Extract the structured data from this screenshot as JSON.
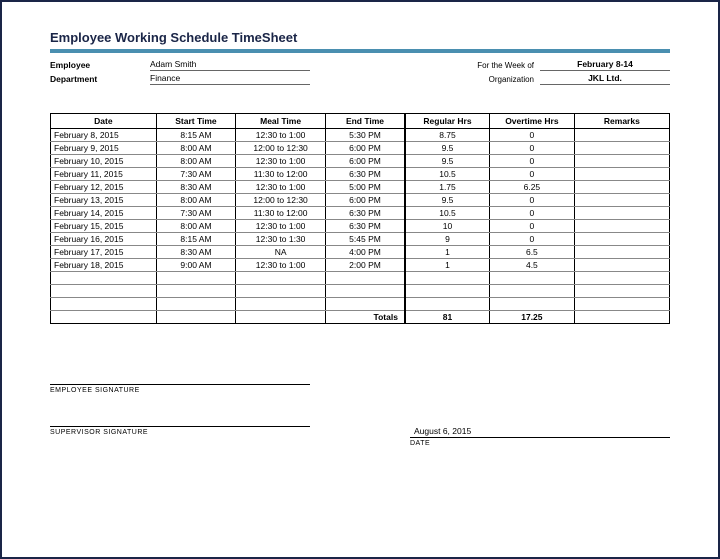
{
  "title": "Employee Working Schedule TimeSheet",
  "info": {
    "employee_label": "Employee",
    "employee_value": "Adam Smith",
    "department_label": "Department",
    "department_value": "Finance",
    "week_label": "For the Week of",
    "week_value": "February 8-14",
    "org_label": "Organization",
    "org_value": "JKL Ltd."
  },
  "headers": {
    "date": "Date",
    "start": "Start Time",
    "meal": "Meal Time",
    "end": "End Time",
    "regular": "Regular Hrs",
    "overtime": "Overtime Hrs",
    "remarks": "Remarks"
  },
  "rows": [
    {
      "date": "February 8, 2015",
      "start": "8:15 AM",
      "meal": "12:30 to 1:00",
      "end": "5:30 PM",
      "reg": "8.75",
      "ot": "0",
      "rem": ""
    },
    {
      "date": "February 9, 2015",
      "start": "8:00 AM",
      "meal": "12:00 to 12:30",
      "end": "6:00 PM",
      "reg": "9.5",
      "ot": "0",
      "rem": ""
    },
    {
      "date": "February 10, 2015",
      "start": "8:00 AM",
      "meal": "12:30 to 1:00",
      "end": "6:00 PM",
      "reg": "9.5",
      "ot": "0",
      "rem": ""
    },
    {
      "date": "February 11, 2015",
      "start": "7:30 AM",
      "meal": "11:30 to 12:00",
      "end": "6:30 PM",
      "reg": "10.5",
      "ot": "0",
      "rem": ""
    },
    {
      "date": "February 12, 2015",
      "start": "8:30 AM",
      "meal": "12:30 to 1:00",
      "end": "5:00 PM",
      "reg": "1.75",
      "ot": "6.25",
      "rem": ""
    },
    {
      "date": "February 13, 2015",
      "start": "8:00 AM",
      "meal": "12:00 to 12:30",
      "end": "6:00 PM",
      "reg": "9.5",
      "ot": "0",
      "rem": ""
    },
    {
      "date": "February 14, 2015",
      "start": "7:30 AM",
      "meal": "11:30 to 12:00",
      "end": "6:30 PM",
      "reg": "10.5",
      "ot": "0",
      "rem": ""
    },
    {
      "date": "February 15, 2015",
      "start": "8:00 AM",
      "meal": "12:30 to 1:00",
      "end": "6:30 PM",
      "reg": "10",
      "ot": "0",
      "rem": ""
    },
    {
      "date": "February 16, 2015",
      "start": "8:15 AM",
      "meal": "12:30 to 1:30",
      "end": "5:45 PM",
      "reg": "9",
      "ot": "0",
      "rem": ""
    },
    {
      "date": "February 17, 2015",
      "start": "8:30 AM",
      "meal": "NA",
      "end": "4:00 PM",
      "reg": "1",
      "ot": "6.5",
      "rem": ""
    },
    {
      "date": "February 18, 2015",
      "start": "9:00 AM",
      "meal": "12:30 to 1:00",
      "end": "2:00 PM",
      "reg": "1",
      "ot": "4.5",
      "rem": ""
    }
  ],
  "totals": {
    "label": "Totals",
    "reg": "81",
    "ot": "17.25"
  },
  "sig": {
    "employee": "EMPLOYEE SIGNATURE",
    "supervisor": "SUPERVISOR SIGNATURE",
    "date_value": "August 6, 2015",
    "date_label": "DATE"
  }
}
